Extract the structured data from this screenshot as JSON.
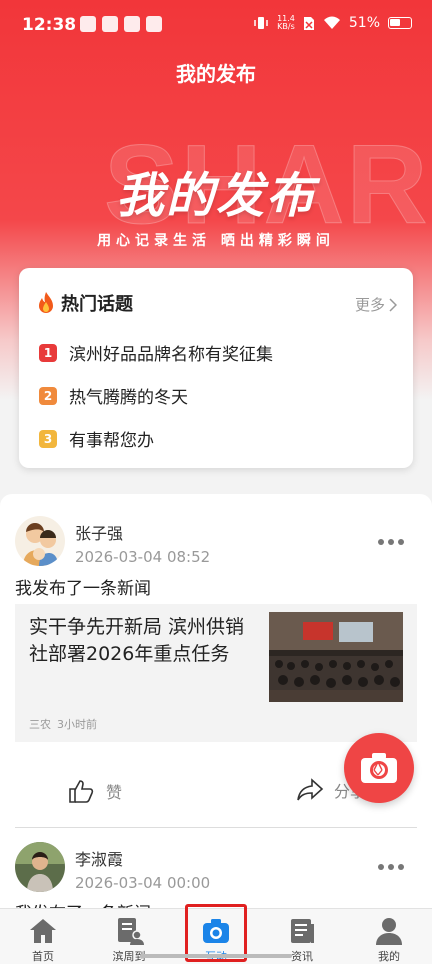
{
  "status_bar": {
    "time": "12:38",
    "speed_value": "11.4",
    "speed_unit": "KB/s",
    "battery": "51%"
  },
  "header": {
    "title": "我的发布"
  },
  "banner": {
    "watermark": "SHARE",
    "title": "我的发布",
    "subtitle": "用心记录生活 晒出精彩瞬间"
  },
  "topics": {
    "title": "热门话题",
    "more_label": "更多",
    "items": [
      {
        "rank": "1",
        "text": "滨州好品品牌名称有奖征集",
        "color": "#e83a3a"
      },
      {
        "rank": "2",
        "text": "热气腾腾的冬天",
        "color": "#f08a3c"
      },
      {
        "rank": "3",
        "text": "有事帮您办",
        "color": "#f2b63c"
      }
    ]
  },
  "posts": [
    {
      "author": "张子强",
      "time": "2026-03-04 08:52",
      "text": "我发布了一条新闻",
      "news": {
        "title": "实干争先开新局 滨州供销社部署2026年重点任务",
        "source": "三农",
        "age": "3小时前"
      },
      "like_label": "赞",
      "share_label": "分享"
    },
    {
      "author": "李淑霞",
      "time": "2026-03-04 00:00",
      "text": "我发布了一条新闻"
    }
  ],
  "tabs": [
    {
      "label": "首页",
      "icon": "home-icon"
    },
    {
      "label": "滨周到",
      "icon": "document-person-icon"
    },
    {
      "label": "互动",
      "icon": "camera-icon"
    },
    {
      "label": "资讯",
      "icon": "news-icon"
    },
    {
      "label": "我的",
      "icon": "user-icon"
    }
  ],
  "colors": {
    "brand_red": "#f2363a",
    "active_blue": "#1b84e8"
  }
}
